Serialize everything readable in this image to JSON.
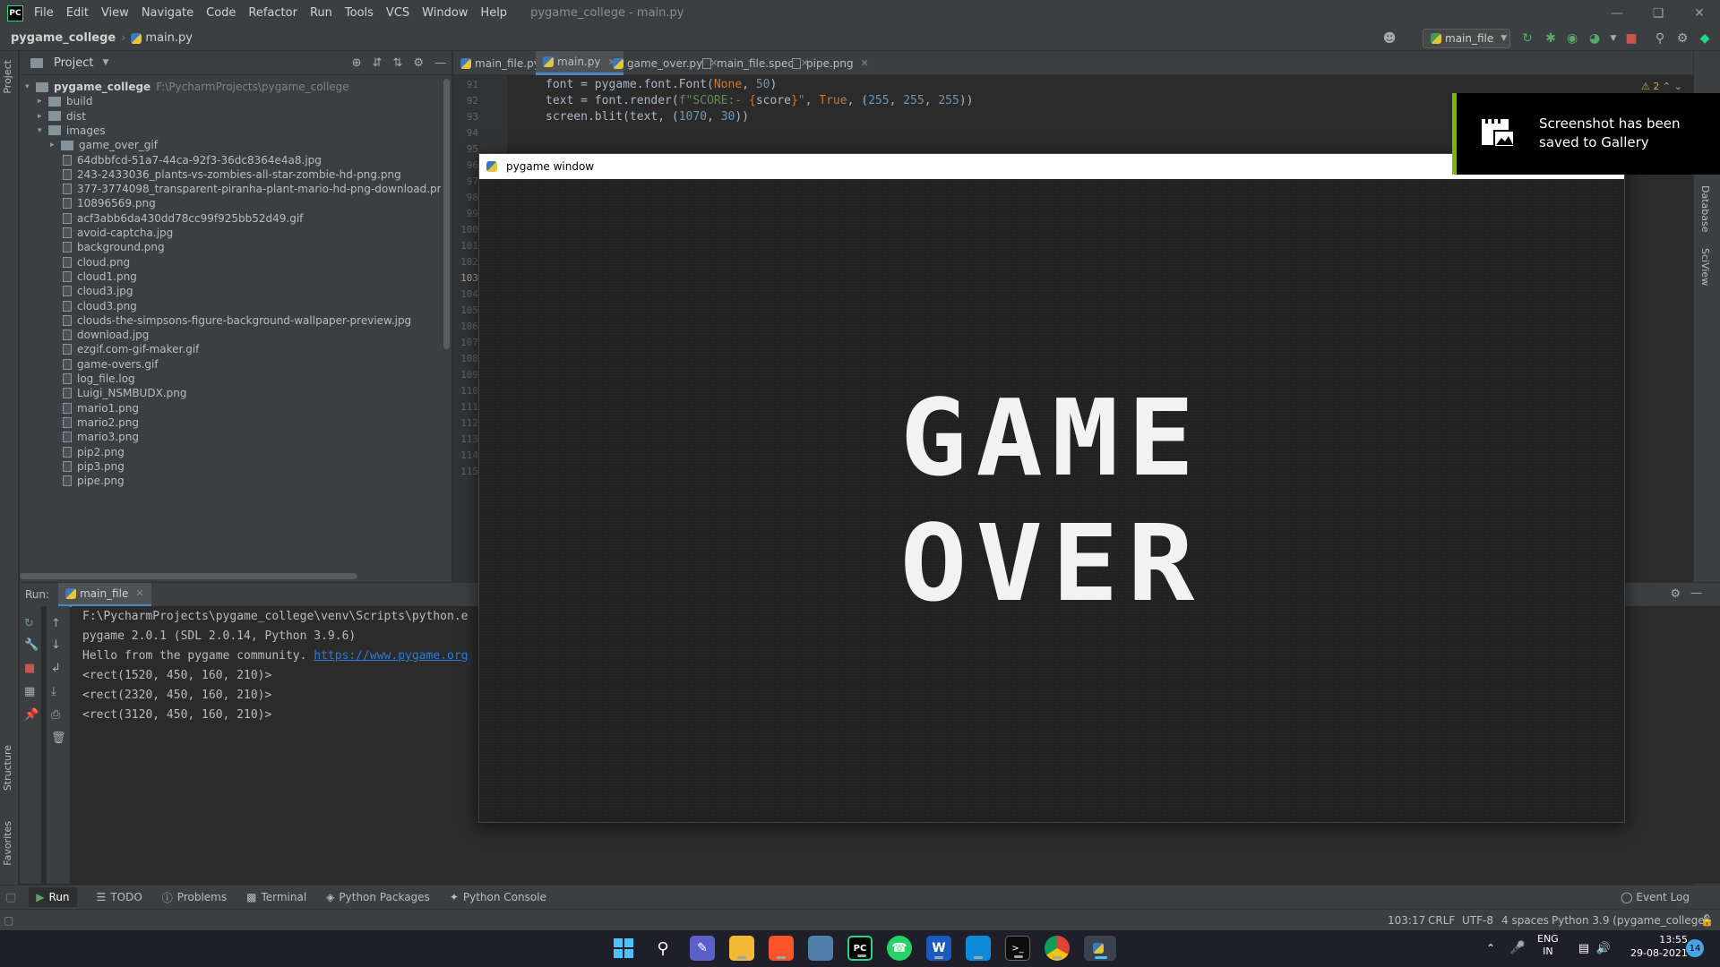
{
  "titlebar": {
    "logo": "PC",
    "menu": [
      "File",
      "Edit",
      "View",
      "Navigate",
      "Code",
      "Refactor",
      "Run",
      "Tools",
      "VCS",
      "Window",
      "Help"
    ],
    "window_title": "pygame_college - main.py"
  },
  "navbar": {
    "project": "pygame_college",
    "file": "main.py",
    "run_config": "main_file"
  },
  "project_panel": {
    "title": "Project",
    "tree": [
      {
        "label": "pygame_college",
        "path": "F:\\PycharmProjects\\pygame_college",
        "type": "folder",
        "level": 0,
        "expanded": true
      },
      {
        "label": "build",
        "type": "folder",
        "level": 1,
        "expanded": false
      },
      {
        "label": "dist",
        "type": "folder",
        "level": 1,
        "expanded": false
      },
      {
        "label": "images",
        "type": "folder",
        "level": 1,
        "expanded": true
      },
      {
        "label": "game_over_gif",
        "type": "folder",
        "level": 2,
        "expanded": false
      },
      {
        "label": "64dbbfcd-51a7-44ca-92f3-36dc8364e4a8.jpg",
        "type": "file",
        "level": 3
      },
      {
        "label": "243-2433036_plants-vs-zombies-all-star-zombie-hd-png.png",
        "type": "file",
        "level": 3
      },
      {
        "label": "377-3774098_transparent-piranha-plant-mario-hd-png-download.png",
        "type": "file",
        "level": 3
      },
      {
        "label": "10896569.png",
        "type": "file",
        "level": 3
      },
      {
        "label": "acf3abb6da430dd78cc99f925bb52d49.gif",
        "type": "file",
        "level": 3
      },
      {
        "label": "avoid-captcha.jpg",
        "type": "file",
        "level": 3
      },
      {
        "label": "background.png",
        "type": "file",
        "level": 3
      },
      {
        "label": "cloud.png",
        "type": "file",
        "level": 3
      },
      {
        "label": "cloud1.png",
        "type": "file",
        "level": 3
      },
      {
        "label": "cloud3.jpg",
        "type": "file",
        "level": 3
      },
      {
        "label": "cloud3.png",
        "type": "file",
        "level": 3
      },
      {
        "label": "clouds-the-simpsons-figure-background-wallpaper-preview.jpg",
        "type": "file",
        "level": 3
      },
      {
        "label": "download.jpg",
        "type": "file",
        "level": 3
      },
      {
        "label": "ezgif.com-gif-maker.gif",
        "type": "file",
        "level": 3
      },
      {
        "label": "game-overs.gif",
        "type": "file",
        "level": 3
      },
      {
        "label": "log_file.log",
        "type": "file",
        "level": 3
      },
      {
        "label": "Luigi_NSMBUDX.png",
        "type": "file",
        "level": 3
      },
      {
        "label": "mario1.png",
        "type": "file",
        "level": 3
      },
      {
        "label": "mario2.png",
        "type": "file",
        "level": 3
      },
      {
        "label": "mario3.png",
        "type": "file",
        "level": 3
      },
      {
        "label": "pip2.png",
        "type": "file",
        "level": 3
      },
      {
        "label": "pip3.png",
        "type": "file",
        "level": 3
      },
      {
        "label": "pipe.png",
        "type": "file",
        "level": 3
      }
    ]
  },
  "editor": {
    "tabs": [
      {
        "label": "main_file.py",
        "kind": "py",
        "active": false
      },
      {
        "label": "main.py",
        "kind": "py",
        "active": true
      },
      {
        "label": "game_over.py",
        "kind": "py",
        "active": false
      },
      {
        "label": "main_file.spec",
        "kind": "file",
        "active": false
      },
      {
        "label": "pipe.png",
        "kind": "file",
        "active": false
      }
    ],
    "line_numbers": [
      "91",
      "92",
      "93",
      "94",
      "95",
      "96",
      "97",
      "98",
      "99",
      "100",
      "101",
      "102",
      "103",
      "104",
      "105",
      "106",
      "107",
      "108",
      "109",
      "110",
      "111",
      "112",
      "113",
      "114",
      "115"
    ],
    "current_line": "103",
    "code": {
      "l91_a": "font = pygame.font.Font(",
      "l91_kw": "None",
      "l91_b": ", ",
      "l91_num": "50",
      "l91_c": ")",
      "l92_a": "text = font.render(",
      "l92_str1": "f\"SCORE:- ",
      "l92_br1": "{",
      "l92_var": "score",
      "l92_br2": "}",
      "l92_str2": "\"",
      "l92_b": ", ",
      "l92_kw": "True",
      "l92_c": ", (",
      "l92_n1": "255",
      "l92_d": ", ",
      "l92_n2": "255",
      "l92_e": ", ",
      "l92_n3": "255",
      "l92_f": "))",
      "l93_a": "screen.blit(text, (",
      "l93_n1": "1070",
      "l93_b": ", ",
      "l93_n2": "30",
      "l93_c": "))"
    },
    "warnings": "2"
  },
  "run_panel": {
    "label": "Run:",
    "tab": "main_file",
    "console": {
      "line1": "F:\\PycharmProjects\\pygame_college\\venv\\Scripts\\python.e",
      "line2": "pygame 2.0.1 (SDL 2.0.14, Python 3.9.6)",
      "line3_text": "Hello from the pygame community. ",
      "line3_link": "https://www.pygame.org",
      "line4": "<rect(1520, 450, 160, 210)>",
      "line5": "<rect(2320, 450, 160, 210)>",
      "line6": "<rect(3120, 450, 160, 210)>"
    }
  },
  "bottom_tabs": {
    "run": "Run",
    "todo": "TODO",
    "problems": "Problems",
    "terminal": "Terminal",
    "python_packages": "Python Packages",
    "python_console": "Python Console",
    "event_log": "Event Log"
  },
  "statusbar": {
    "position": "103:17",
    "line_sep": "CRLF",
    "encoding": "UTF-8",
    "indent": "4 spaces",
    "interpreter": "Python 3.9 (pygame_college)"
  },
  "left_strip": {
    "project": "Project",
    "structure": "Structure",
    "favorites": "Favorites"
  },
  "right_strip": {
    "database": "Database",
    "sciview": "SciView"
  },
  "pygame_window": {
    "title": "pygame window",
    "game_over_line1": "GAME",
    "game_over_line2": "OVER"
  },
  "toast": {
    "text": "Screenshot has been saved to Gallery",
    "accent": "#76b900"
  },
  "taskbar": {
    "lang_top": "ENG",
    "lang_bottom": "IN",
    "time": "13:55",
    "date": "29-08-2021",
    "notification_count": "14"
  }
}
